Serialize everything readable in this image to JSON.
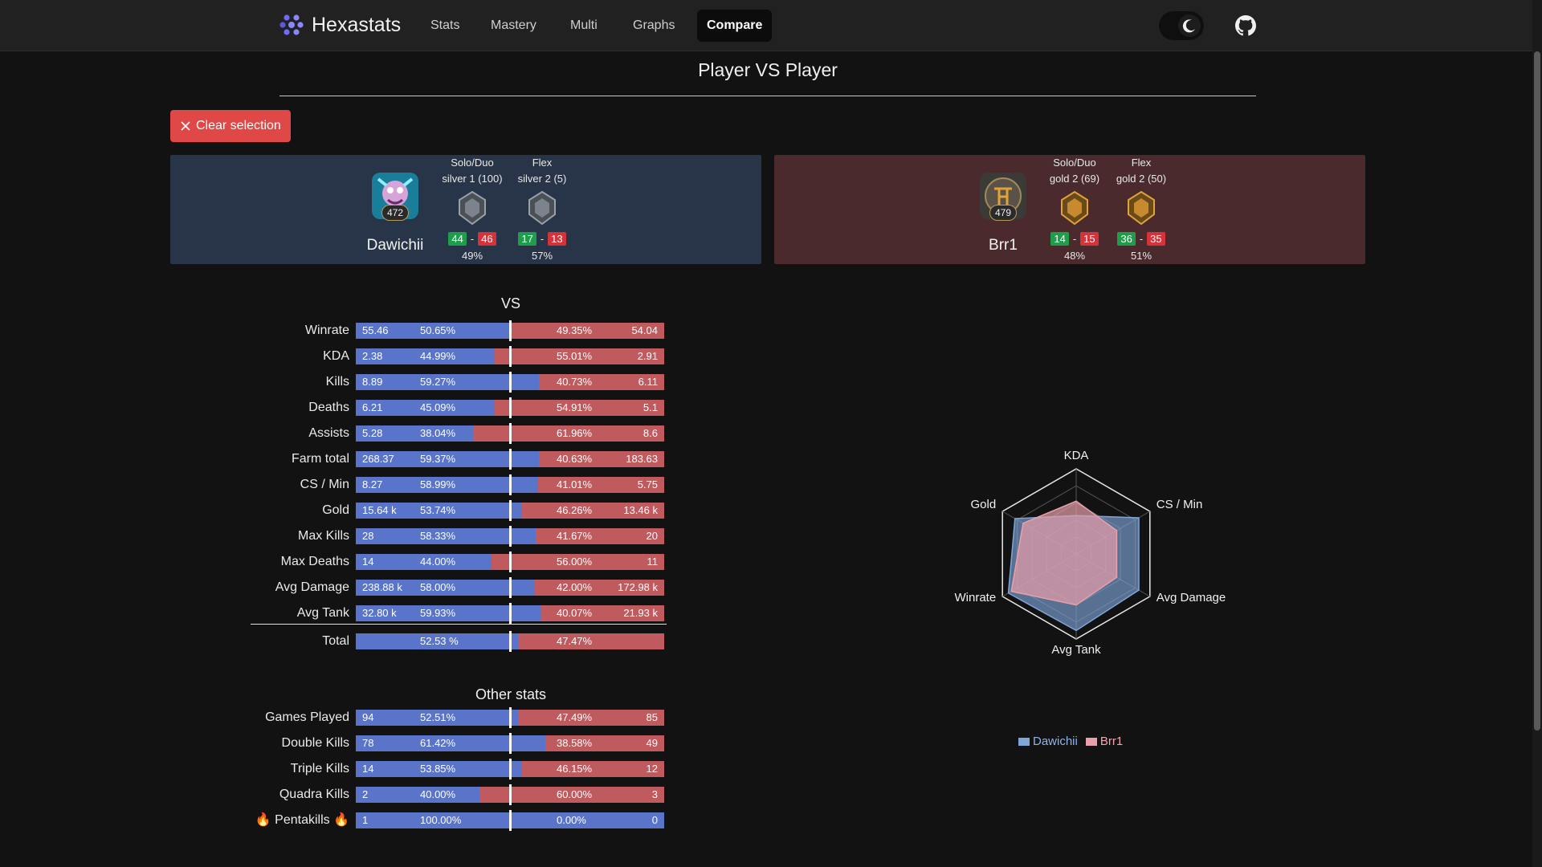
{
  "nav": {
    "brand": "Hexastats",
    "links": [
      "Stats",
      "Mastery",
      "Multi",
      "Graphs",
      "Compare"
    ],
    "active": "Compare"
  },
  "page_title": "Player VS Player",
  "clear_button": "Clear selection",
  "players": [
    {
      "name": "Dawichii",
      "level": "472",
      "queues": [
        {
          "title": "Solo/Duo",
          "rank": "silver 1 (100)",
          "wins": "44",
          "losses": "46",
          "winrate": "49%"
        },
        {
          "title": "Flex",
          "rank": "silver 2 (5)",
          "wins": "17",
          "losses": "13",
          "winrate": "57%"
        }
      ]
    },
    {
      "name": "Brr1",
      "level": "479",
      "queues": [
        {
          "title": "Solo/Duo",
          "rank": "gold 2 (69)",
          "wins": "14",
          "losses": "15",
          "winrate": "48%"
        },
        {
          "title": "Flex",
          "rank": "gold 2 (50)",
          "wins": "36",
          "losses": "35",
          "winrate": "51%"
        }
      ]
    }
  ],
  "vs_title": "VS",
  "vs_rows": [
    {
      "label": "Winrate",
      "lv": "55.46",
      "lp": "50.65%",
      "rp": "49.35%",
      "rv": "54.04",
      "frac": 0.5065
    },
    {
      "label": "KDA",
      "lv": "2.38",
      "lp": "44.99%",
      "rp": "55.01%",
      "rv": "2.91",
      "frac": 0.4499
    },
    {
      "label": "Kills",
      "lv": "8.89",
      "lp": "59.27%",
      "rp": "40.73%",
      "rv": "6.11",
      "frac": 0.5927
    },
    {
      "label": "Deaths",
      "lv": "6.21",
      "lp": "45.09%",
      "rp": "54.91%",
      "rv": "5.1",
      "frac": 0.4509
    },
    {
      "label": "Assists",
      "lv": "5.28",
      "lp": "38.04%",
      "rp": "61.96%",
      "rv": "8.6",
      "frac": 0.3804
    },
    {
      "label": "Farm total",
      "lv": "268.37",
      "lp": "59.37%",
      "rp": "40.63%",
      "rv": "183.63",
      "frac": 0.5937
    },
    {
      "label": "CS / Min",
      "lv": "8.27",
      "lp": "58.99%",
      "rp": "41.01%",
      "rv": "5.75",
      "frac": 0.5899
    },
    {
      "label": "Gold",
      "lv": "15.64 k",
      "lp": "53.74%",
      "rp": "46.26%",
      "rv": "13.46 k",
      "frac": 0.5374
    },
    {
      "label": "Max Kills",
      "lv": "28",
      "lp": "58.33%",
      "rp": "41.67%",
      "rv": "20",
      "frac": 0.5833
    },
    {
      "label": "Max Deaths",
      "lv": "14",
      "lp": "44.00%",
      "rp": "56.00%",
      "rv": "11",
      "frac": 0.44
    },
    {
      "label": "Avg Damage",
      "lv": "238.88 k",
      "lp": "58.00%",
      "rp": "42.00%",
      "rv": "172.98 k",
      "frac": 0.58
    },
    {
      "label": "Avg Tank",
      "lv": "32.80 k",
      "lp": "59.93%",
      "rp": "40.07%",
      "rv": "21.93 k",
      "frac": 0.5993
    }
  ],
  "total_row": {
    "label": "Total",
    "lv": "",
    "lp": "52.53 %",
    "rp": "47.47%",
    "rv": "",
    "frac": 0.5253
  },
  "other_title": "Other stats",
  "other_rows": [
    {
      "label": "Games Played",
      "lv": "94",
      "lp": "52.51%",
      "rp": "47.49%",
      "rv": "85",
      "frac": 0.5251
    },
    {
      "label": "Double Kills",
      "lv": "78",
      "lp": "61.42%",
      "rp": "38.58%",
      "rv": "49",
      "frac": 0.6142
    },
    {
      "label": "Triple Kills",
      "lv": "14",
      "lp": "53.85%",
      "rp": "46.15%",
      "rv": "12",
      "frac": 0.5385
    },
    {
      "label": "Quadra Kills",
      "lv": "2",
      "lp": "40.00%",
      "rp": "60.00%",
      "rv": "3",
      "frac": 0.4
    },
    {
      "label": "🔥 Pentakills 🔥",
      "lv": "1",
      "lp": "100.00%",
      "rp": "0.00%",
      "rv": "0",
      "frac": 1.0
    }
  ],
  "radar": {
    "axes": [
      "KDA",
      "CS / Min",
      "Avg Damage",
      "Avg Tank",
      "Winrate",
      "Gold"
    ],
    "series": [
      {
        "name": "Dawichii",
        "values": [
          0.45,
          0.85,
          0.85,
          0.9,
          0.92,
          0.83
        ],
        "color": "#7ea4d8"
      },
      {
        "name": "Brr1",
        "values": [
          0.62,
          0.55,
          0.55,
          0.6,
          0.88,
          0.72
        ],
        "color": "#e8a0aa"
      }
    ]
  },
  "colors": {
    "blue_bar": "#5a74c9",
    "red_bar": "#bf5b5f",
    "danger": "#e04848"
  }
}
